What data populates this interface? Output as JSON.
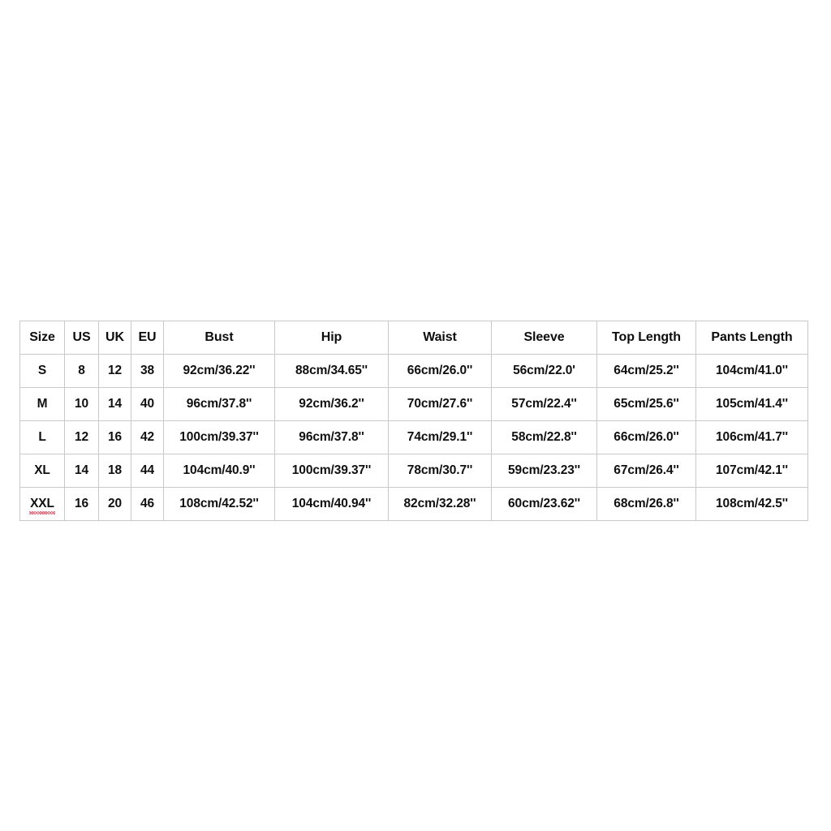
{
  "table": {
    "name": "size-chart",
    "columns": [
      "Size",
      "US",
      "UK",
      "EU",
      "Bust",
      "Hip",
      "Waist",
      "Sleeve",
      "Top Length",
      "Pants Length"
    ],
    "rows": [
      {
        "size": "S",
        "size_misspelled": false,
        "us": "8",
        "uk": "12",
        "eu": "38",
        "bust": "92cm/36.22''",
        "hip": "88cm/34.65''",
        "waist": "66cm/26.0''",
        "sleeve": "56cm/22.0'",
        "top_length": "64cm/25.2''",
        "pants_length": "104cm/41.0''"
      },
      {
        "size": "M",
        "size_misspelled": false,
        "us": "10",
        "uk": "14",
        "eu": "40",
        "bust": "96cm/37.8''",
        "hip": "92cm/36.2''",
        "waist": "70cm/27.6''",
        "sleeve": "57cm/22.4''",
        "top_length": "65cm/25.6''",
        "pants_length": "105cm/41.4''"
      },
      {
        "size": "L",
        "size_misspelled": false,
        "us": "12",
        "uk": "16",
        "eu": "42",
        "bust": "100cm/39.37''",
        "hip": "96cm/37.8''",
        "waist": "74cm/29.1''",
        "sleeve": "58cm/22.8''",
        "top_length": "66cm/26.0''",
        "pants_length": "106cm/41.7''"
      },
      {
        "size": "XL",
        "size_misspelled": false,
        "us": "14",
        "uk": "18",
        "eu": "44",
        "bust": "104cm/40.9''",
        "hip": "100cm/39.37''",
        "waist": "78cm/30.7''",
        "sleeve": "59cm/23.23''",
        "top_length": "67cm/26.4''",
        "pants_length": "107cm/42.1''"
      },
      {
        "size": "XXL",
        "size_misspelled": true,
        "us": "16",
        "uk": "20",
        "eu": "46",
        "bust": "108cm/42.52''",
        "hip": "104cm/40.94''",
        "waist": "82cm/32.28''",
        "sleeve": "60cm/23.62''",
        "top_length": "68cm/26.8''",
        "pants_length": "108cm/42.5''"
      }
    ]
  },
  "colors": {
    "background": "#ffffff",
    "border": "#c9c9c9",
    "text": "#101010",
    "spellcheck_underline": "#e06a7a"
  }
}
